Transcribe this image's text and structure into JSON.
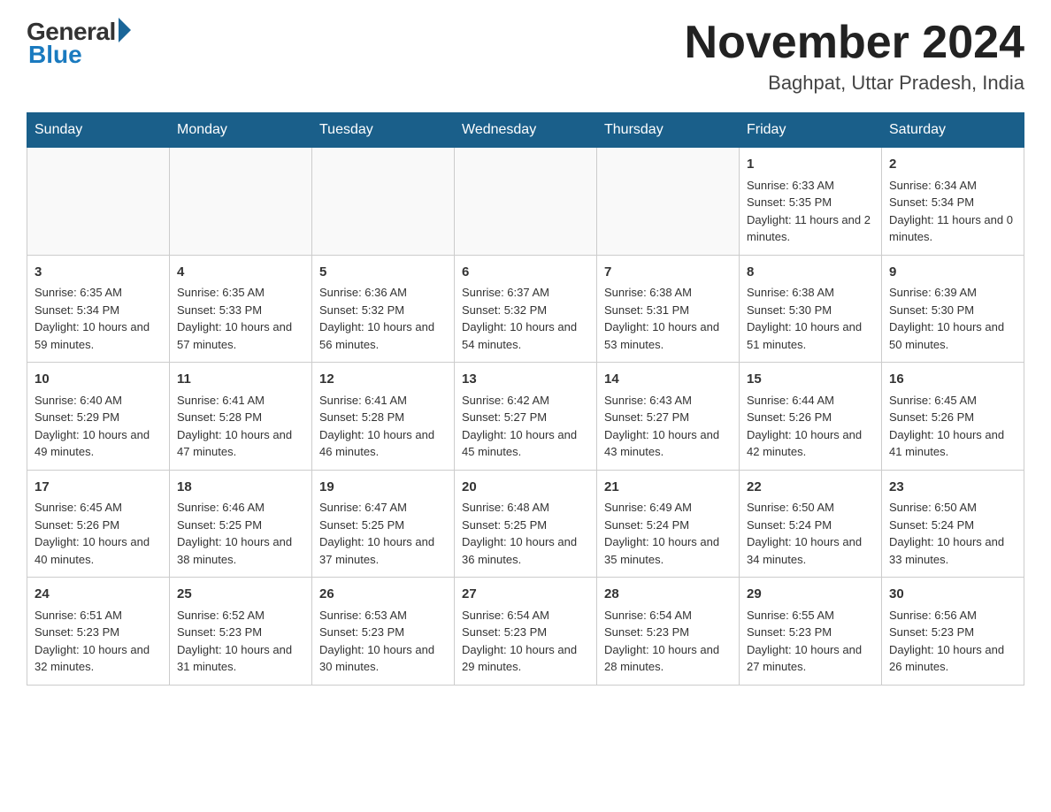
{
  "header": {
    "logo_general": "General",
    "logo_blue": "Blue",
    "month_title": "November 2024",
    "location": "Baghpat, Uttar Pradesh, India"
  },
  "days_of_week": [
    "Sunday",
    "Monday",
    "Tuesday",
    "Wednesday",
    "Thursday",
    "Friday",
    "Saturday"
  ],
  "weeks": [
    [
      {
        "day": "",
        "info": ""
      },
      {
        "day": "",
        "info": ""
      },
      {
        "day": "",
        "info": ""
      },
      {
        "day": "",
        "info": ""
      },
      {
        "day": "",
        "info": ""
      },
      {
        "day": "1",
        "info": "Sunrise: 6:33 AM\nSunset: 5:35 PM\nDaylight: 11 hours and 2 minutes."
      },
      {
        "day": "2",
        "info": "Sunrise: 6:34 AM\nSunset: 5:34 PM\nDaylight: 11 hours and 0 minutes."
      }
    ],
    [
      {
        "day": "3",
        "info": "Sunrise: 6:35 AM\nSunset: 5:34 PM\nDaylight: 10 hours and 59 minutes."
      },
      {
        "day": "4",
        "info": "Sunrise: 6:35 AM\nSunset: 5:33 PM\nDaylight: 10 hours and 57 minutes."
      },
      {
        "day": "5",
        "info": "Sunrise: 6:36 AM\nSunset: 5:32 PM\nDaylight: 10 hours and 56 minutes."
      },
      {
        "day": "6",
        "info": "Sunrise: 6:37 AM\nSunset: 5:32 PM\nDaylight: 10 hours and 54 minutes."
      },
      {
        "day": "7",
        "info": "Sunrise: 6:38 AM\nSunset: 5:31 PM\nDaylight: 10 hours and 53 minutes."
      },
      {
        "day": "8",
        "info": "Sunrise: 6:38 AM\nSunset: 5:30 PM\nDaylight: 10 hours and 51 minutes."
      },
      {
        "day": "9",
        "info": "Sunrise: 6:39 AM\nSunset: 5:30 PM\nDaylight: 10 hours and 50 minutes."
      }
    ],
    [
      {
        "day": "10",
        "info": "Sunrise: 6:40 AM\nSunset: 5:29 PM\nDaylight: 10 hours and 49 minutes."
      },
      {
        "day": "11",
        "info": "Sunrise: 6:41 AM\nSunset: 5:28 PM\nDaylight: 10 hours and 47 minutes."
      },
      {
        "day": "12",
        "info": "Sunrise: 6:41 AM\nSunset: 5:28 PM\nDaylight: 10 hours and 46 minutes."
      },
      {
        "day": "13",
        "info": "Sunrise: 6:42 AM\nSunset: 5:27 PM\nDaylight: 10 hours and 45 minutes."
      },
      {
        "day": "14",
        "info": "Sunrise: 6:43 AM\nSunset: 5:27 PM\nDaylight: 10 hours and 43 minutes."
      },
      {
        "day": "15",
        "info": "Sunrise: 6:44 AM\nSunset: 5:26 PM\nDaylight: 10 hours and 42 minutes."
      },
      {
        "day": "16",
        "info": "Sunrise: 6:45 AM\nSunset: 5:26 PM\nDaylight: 10 hours and 41 minutes."
      }
    ],
    [
      {
        "day": "17",
        "info": "Sunrise: 6:45 AM\nSunset: 5:26 PM\nDaylight: 10 hours and 40 minutes."
      },
      {
        "day": "18",
        "info": "Sunrise: 6:46 AM\nSunset: 5:25 PM\nDaylight: 10 hours and 38 minutes."
      },
      {
        "day": "19",
        "info": "Sunrise: 6:47 AM\nSunset: 5:25 PM\nDaylight: 10 hours and 37 minutes."
      },
      {
        "day": "20",
        "info": "Sunrise: 6:48 AM\nSunset: 5:25 PM\nDaylight: 10 hours and 36 minutes."
      },
      {
        "day": "21",
        "info": "Sunrise: 6:49 AM\nSunset: 5:24 PM\nDaylight: 10 hours and 35 minutes."
      },
      {
        "day": "22",
        "info": "Sunrise: 6:50 AM\nSunset: 5:24 PM\nDaylight: 10 hours and 34 minutes."
      },
      {
        "day": "23",
        "info": "Sunrise: 6:50 AM\nSunset: 5:24 PM\nDaylight: 10 hours and 33 minutes."
      }
    ],
    [
      {
        "day": "24",
        "info": "Sunrise: 6:51 AM\nSunset: 5:23 PM\nDaylight: 10 hours and 32 minutes."
      },
      {
        "day": "25",
        "info": "Sunrise: 6:52 AM\nSunset: 5:23 PM\nDaylight: 10 hours and 31 minutes."
      },
      {
        "day": "26",
        "info": "Sunrise: 6:53 AM\nSunset: 5:23 PM\nDaylight: 10 hours and 30 minutes."
      },
      {
        "day": "27",
        "info": "Sunrise: 6:54 AM\nSunset: 5:23 PM\nDaylight: 10 hours and 29 minutes."
      },
      {
        "day": "28",
        "info": "Sunrise: 6:54 AM\nSunset: 5:23 PM\nDaylight: 10 hours and 28 minutes."
      },
      {
        "day": "29",
        "info": "Sunrise: 6:55 AM\nSunset: 5:23 PM\nDaylight: 10 hours and 27 minutes."
      },
      {
        "day": "30",
        "info": "Sunrise: 6:56 AM\nSunset: 5:23 PM\nDaylight: 10 hours and 26 minutes."
      }
    ]
  ]
}
